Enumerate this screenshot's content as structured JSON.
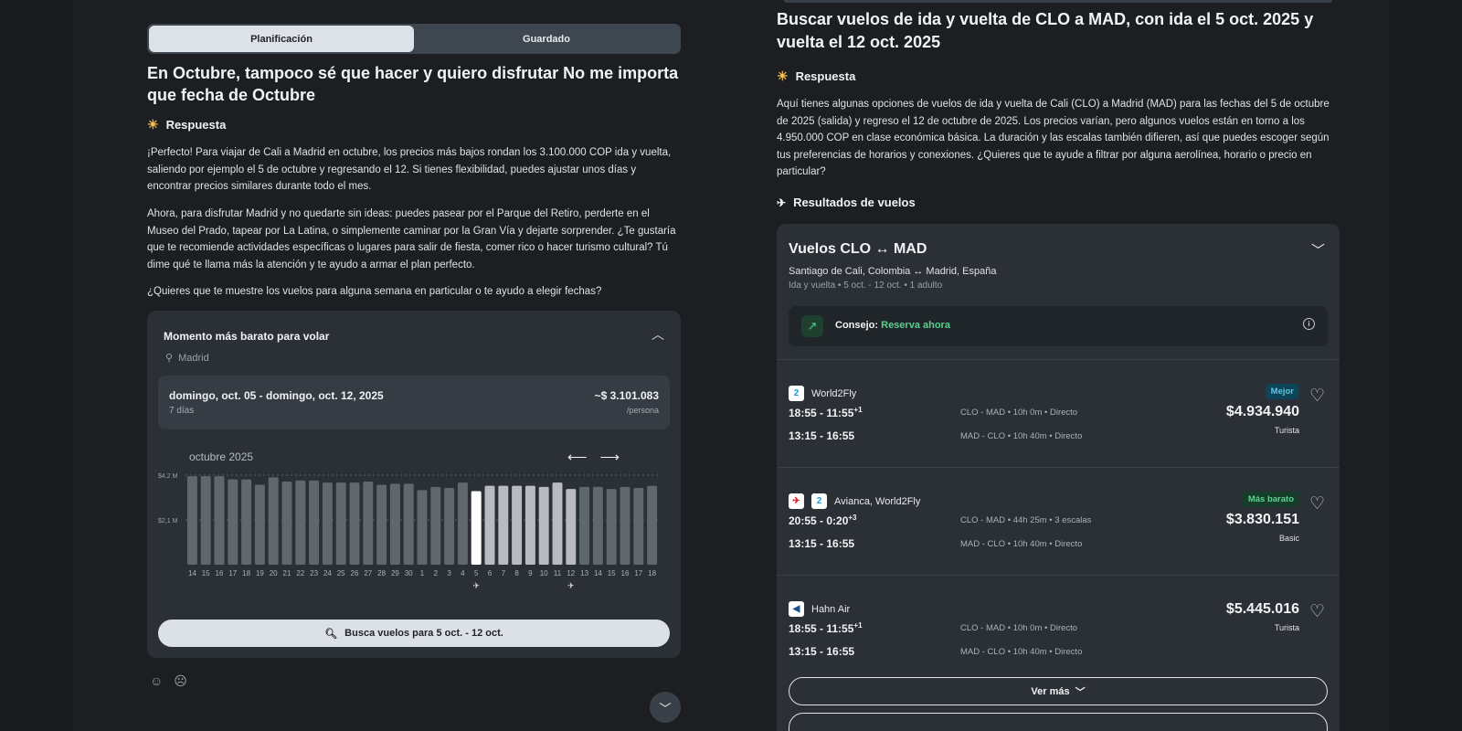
{
  "tabs": [
    {
      "label": "Planificación",
      "active": true
    },
    {
      "label": "Guardado",
      "active": false
    }
  ],
  "left": {
    "question": "En Octubre, tampoco sé que hacer y quiero disfrutar No me importa que fecha de Octubre",
    "response_label": "Respuesta",
    "paragraphs": [
      "¡Perfecto! Para viajar de Cali a Madrid en octubre, los precios más bajos rondan los 3.100.000 COP ida y vuelta, saliendo por ejemplo el 5 de octubre y regresando el 12. Si tienes flexibilidad, puedes ajustar unos días y encontrar precios similares durante todo el mes.",
      "Ahora, para disfrutar Madrid y no quedarte sin ideas: puedes pasear por el Parque del Retiro, perderte en el Museo del Prado, tapear por La Latina, o simplemente caminar por la Gran Vía y dejarte sorprender. ¿Te gustaría que te recomiende actividades específicas o lugares para salir de fiesta, comer rico o hacer turismo cultural? Tú dime qué te llama más la atención y te ayudo a armar el plan perfecto.",
      "¿Quieres que te muestre los vuelos para alguna semana en particular o te ayudo a elegir fechas?"
    ],
    "cheapest": {
      "title": "Momento más barato para volar",
      "location": "Madrid",
      "dates": "domingo, oct. 05 - domingo, oct. 12, 2025",
      "duration": "7 días",
      "price": "~$ 3.101.083",
      "per": "/persona",
      "month": "octubre 2025",
      "search_label": "Busca vuelos para 5 oct. - 12 oct."
    }
  },
  "chart_data": {
    "type": "bar",
    "ytick_labels": [
      "$4,2 M",
      "$2,1 M"
    ],
    "yticks": [
      4.2,
      2.1
    ],
    "ylim": [
      0,
      4.2
    ],
    "categories": [
      "14",
      "15",
      "16",
      "17",
      "18",
      "19",
      "20",
      "21",
      "22",
      "23",
      "24",
      "25",
      "26",
      "27",
      "28",
      "29",
      "30",
      "1",
      "2",
      "3",
      "4",
      "5",
      "6",
      "7",
      "8",
      "9",
      "10",
      "11",
      "12",
      "13",
      "14",
      "15",
      "16",
      "17",
      "18"
    ],
    "values": [
      4.15,
      4.15,
      4.15,
      4.0,
      4.0,
      3.75,
      4.1,
      3.9,
      3.95,
      3.95,
      3.85,
      3.85,
      3.85,
      3.9,
      3.75,
      3.8,
      3.8,
      3.5,
      3.65,
      3.6,
      3.85,
      3.45,
      3.7,
      3.7,
      3.7,
      3.7,
      3.65,
      3.85,
      3.55,
      3.65,
      3.65,
      3.55,
      3.65,
      3.6,
      3.7
    ],
    "highlight_index": 21,
    "selected_range": [
      22,
      28
    ],
    "depart_index": 21,
    "return_index": 28
  },
  "right": {
    "title": "Buscar vuelos de ida y vuelta de CLO a MAD, con ida el 5 oct. 2025 y vuelta el 12 oct. 2025",
    "response_label": "Respuesta",
    "paragraph": "Aquí tienes algunas opciones de vuelos de ida y vuelta de Cali (CLO) a Madrid (MAD) para las fechas del 5 de octubre de 2025 (salida) y regreso el 12 de octubre de 2025. Los precios varían, pero algunos vuelos están en torno a los 4.950.000 COP en clase económica básica. La duración y las escalas también difieren, así que puedes escoger según tus preferencias de horarios y conexiones. ¿Quieres que te ayude a filtrar por alguna aerolínea, horario o precio en particular?",
    "results_label": "Resultados de vuelos",
    "card": {
      "title": "Vuelos CLO ↔ MAD",
      "route": "Santiago de Cali, Colombia ↔ Madrid, España",
      "meta": "Ida y vuelta • 5 oct. - 12 oct. • 1 adulto",
      "tip_prefix": "Consejo:",
      "tip_action": "Reserva ahora",
      "more_label": "Ver más"
    },
    "flights": [
      {
        "airline": "World2Fly",
        "out_time": "18:55 - 11:55",
        "out_sup": "+1",
        "out_route": "CLO - MAD • 10h 0m • Directo",
        "ret_time": "13:15 - 16:55",
        "ret_route": "MAD - CLO • 10h 40m • Directo",
        "badge": "Mejor",
        "price": "$4.934.940",
        "class": "Turista"
      },
      {
        "airline": "Avianca, World2Fly",
        "out_time": "20:55 - 0:20",
        "out_sup": "+3",
        "out_route": "CLO - MAD • 44h 25m • 3 escalas",
        "ret_time": "13:15 - 16:55",
        "ret_route": "MAD - CLO • 10h 40m • Directo",
        "badge": "Más barato",
        "price": "$3.830.151",
        "class": "Basic"
      },
      {
        "airline": "Hahn Air",
        "out_time": "18:55 - 11:55",
        "out_sup": "+1",
        "out_route": "CLO - MAD • 10h 0m • Directo",
        "ret_time": "13:15 - 16:55",
        "ret_route": "MAD - CLO • 10h 40m • Directo",
        "badge": "",
        "price": "$5.445.016",
        "class": "Turista"
      }
    ],
    "colors": {
      "best_badge": "#58c8e8",
      "cheap_badge": "#5ed394",
      "accent_green": "#55d08d"
    }
  }
}
